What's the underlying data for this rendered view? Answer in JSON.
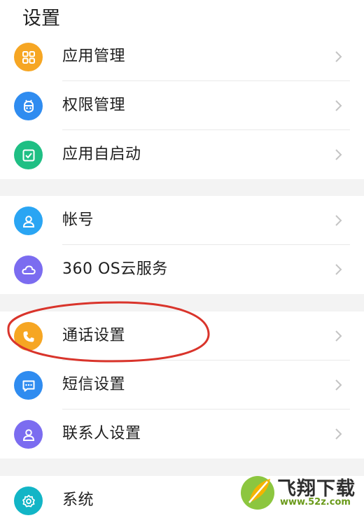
{
  "header": {
    "title": "设置"
  },
  "groups": [
    [
      {
        "label": "应用管理",
        "icon": "grid-apps-icon",
        "color": "#F6A623"
      },
      {
        "label": "权限管理",
        "icon": "robot-shield-icon",
        "color": "#2F8CF0"
      },
      {
        "label": "应用自启动",
        "icon": "checkbox-icon",
        "color": "#1FBF84"
      }
    ],
    [
      {
        "label": "帐号",
        "icon": "user-icon",
        "color": "#2AA5F3"
      },
      {
        "label": "360 OS云服务",
        "icon": "cloud-icon",
        "color": "#7B6CF0"
      }
    ],
    [
      {
        "label": "通话设置",
        "icon": "phone-icon",
        "color": "#F6A623"
      },
      {
        "label": "短信设置",
        "icon": "message-icon",
        "color": "#2F8CF0"
      },
      {
        "label": "联系人设置",
        "icon": "contact-icon",
        "color": "#7B6CF0"
      }
    ],
    [
      {
        "label": "系统",
        "icon": "gear-icon",
        "color": "#12B5C6"
      }
    ]
  ],
  "annotation": {
    "color": "#D9342B"
  },
  "watermark": {
    "title": "飞翔下载",
    "url": "www.52z.com"
  }
}
